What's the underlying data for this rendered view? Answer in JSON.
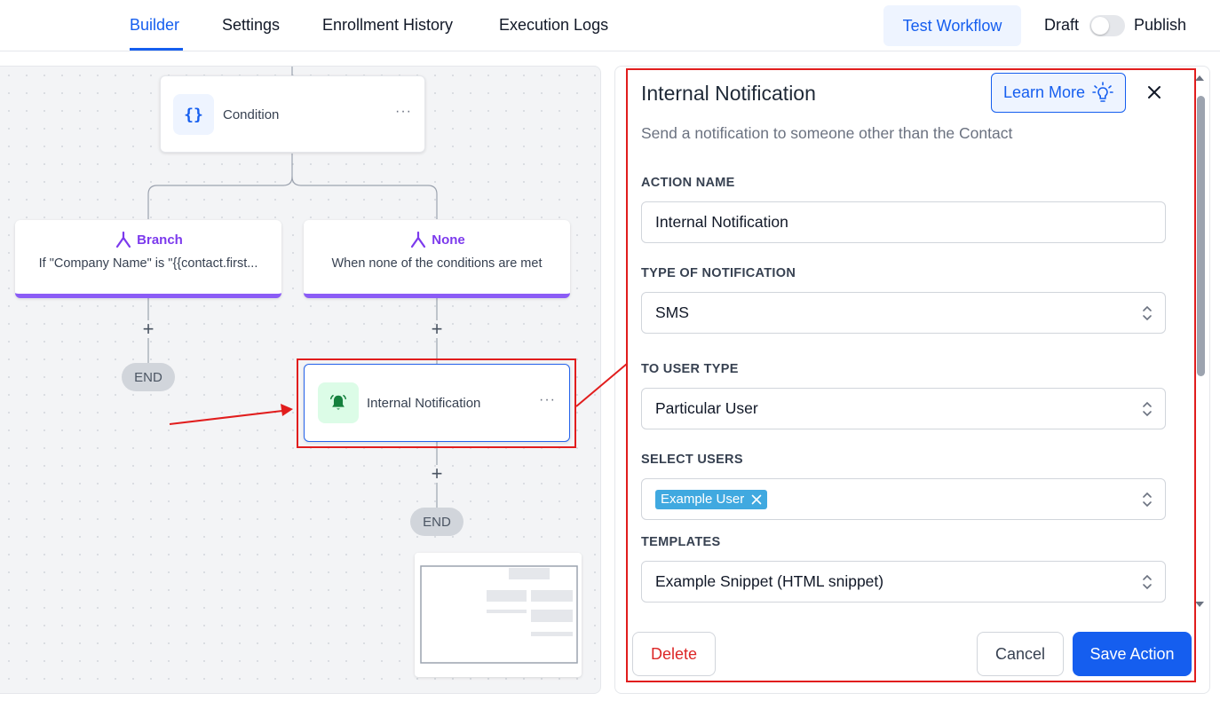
{
  "tabs": [
    {
      "label": "Builder",
      "active": true
    },
    {
      "label": "Settings",
      "active": false
    },
    {
      "label": "Enrollment History",
      "active": false
    },
    {
      "label": "Execution Logs",
      "active": false
    }
  ],
  "header": {
    "test_workflow": "Test Workflow",
    "draft": "Draft",
    "publish": "Publish",
    "published": false
  },
  "canvas": {
    "condition_node": {
      "title": "Condition",
      "menu": "···"
    },
    "branches": [
      {
        "name": "Branch",
        "description": "If \"Company Name\" is \"{{contact.first..."
      },
      {
        "name": "None",
        "description": "When none of the conditions are met"
      }
    ],
    "plus_label": "+",
    "end_label": "END",
    "action_node": {
      "title": "Internal Notification",
      "menu": "···"
    }
  },
  "panel": {
    "title": "Internal Notification",
    "learn_more": "Learn More",
    "subtitle": "Send a notification to someone other than the Contact",
    "fields": {
      "action_name": {
        "label": "ACTION NAME",
        "value": "Internal Notification"
      },
      "notification_type": {
        "label": "TYPE OF NOTIFICATION",
        "value": "SMS"
      },
      "user_type": {
        "label": "TO USER TYPE",
        "value": "Particular User"
      },
      "select_users": {
        "label": "SELECT USERS",
        "chips": [
          "Example User"
        ]
      },
      "templates": {
        "label": "TEMPLATES",
        "value": "Example Snippet (HTML snippet)"
      }
    },
    "delete": "Delete",
    "cancel": "Cancel",
    "save": "Save Action"
  },
  "colors": {
    "accent": "#155eef",
    "branch_purple": "#7c3aed",
    "notification_green": "#15803d",
    "annotation_red": "#e11d1d",
    "delete_red": "#dc2626"
  }
}
